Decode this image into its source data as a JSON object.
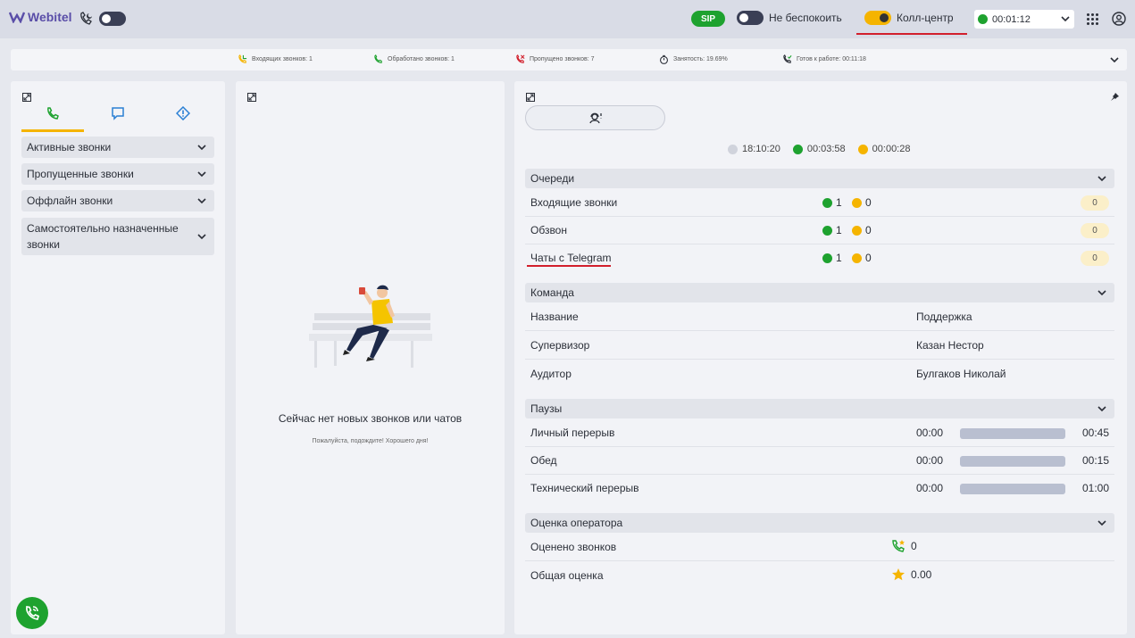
{
  "app": {
    "logo_text": "Webitel"
  },
  "topbar": {
    "sip_label": "SIP",
    "dnd_label": "Не беспокоить",
    "callcenter_label": "Колл-центр",
    "timer_value": "00:01:12",
    "timer_status_color": "#1ea22f"
  },
  "stats": {
    "incoming": "Входящих звонков: 1",
    "processed": "Обработано звонков: 1",
    "missed": "Пропущено звонков: 7",
    "busy": "Занятость: 19.69%",
    "ready": "Готов к работе: 00:11:18"
  },
  "left": {
    "accordions": [
      "Активные звонки",
      "Пропущенные звонки",
      "Оффлайн звонки",
      "Самостоятельно назначенные звонки"
    ]
  },
  "middle": {
    "empty_title": "Сейчас нет новых звонков или чатов",
    "empty_subtitle": "Пожалуйста, подождите! Хорошего дня!"
  },
  "right": {
    "timers": {
      "offline": "18:10:20",
      "online": "00:03:58",
      "pause": "00:00:28"
    },
    "queues": {
      "title": "Очереди",
      "rows": [
        {
          "name": "Входящие звонки",
          "green": "1",
          "yellow": "0",
          "badge": "0"
        },
        {
          "name": "Обзвон",
          "green": "1",
          "yellow": "0",
          "badge": "0"
        },
        {
          "name": "Чаты с Telegram",
          "green": "1",
          "yellow": "0",
          "badge": "0"
        }
      ]
    },
    "team": {
      "title": "Команда",
      "rows": [
        {
          "label": "Название",
          "value": "Поддержка"
        },
        {
          "label": "Супервизор",
          "value": "Казан Нестор"
        },
        {
          "label": "Аудитор",
          "value": "Булгаков Николай"
        }
      ]
    },
    "pauses": {
      "title": "Паузы",
      "rows": [
        {
          "name": "Личный перерыв",
          "start": "00:00",
          "end": "00:45"
        },
        {
          "name": "Обед",
          "start": "00:00",
          "end": "00:15"
        },
        {
          "name": "Технический перерыв",
          "start": "00:00",
          "end": "01:00"
        }
      ]
    },
    "rating": {
      "title": "Оценка оператора",
      "rows": [
        {
          "label": "Оценено звонков",
          "value": "0"
        },
        {
          "label": "Общая оценка",
          "value": "0.00"
        }
      ]
    }
  },
  "colors": {
    "green": "#1ea22f",
    "yellow": "#f5b400",
    "accent_red": "#d21f2c"
  }
}
